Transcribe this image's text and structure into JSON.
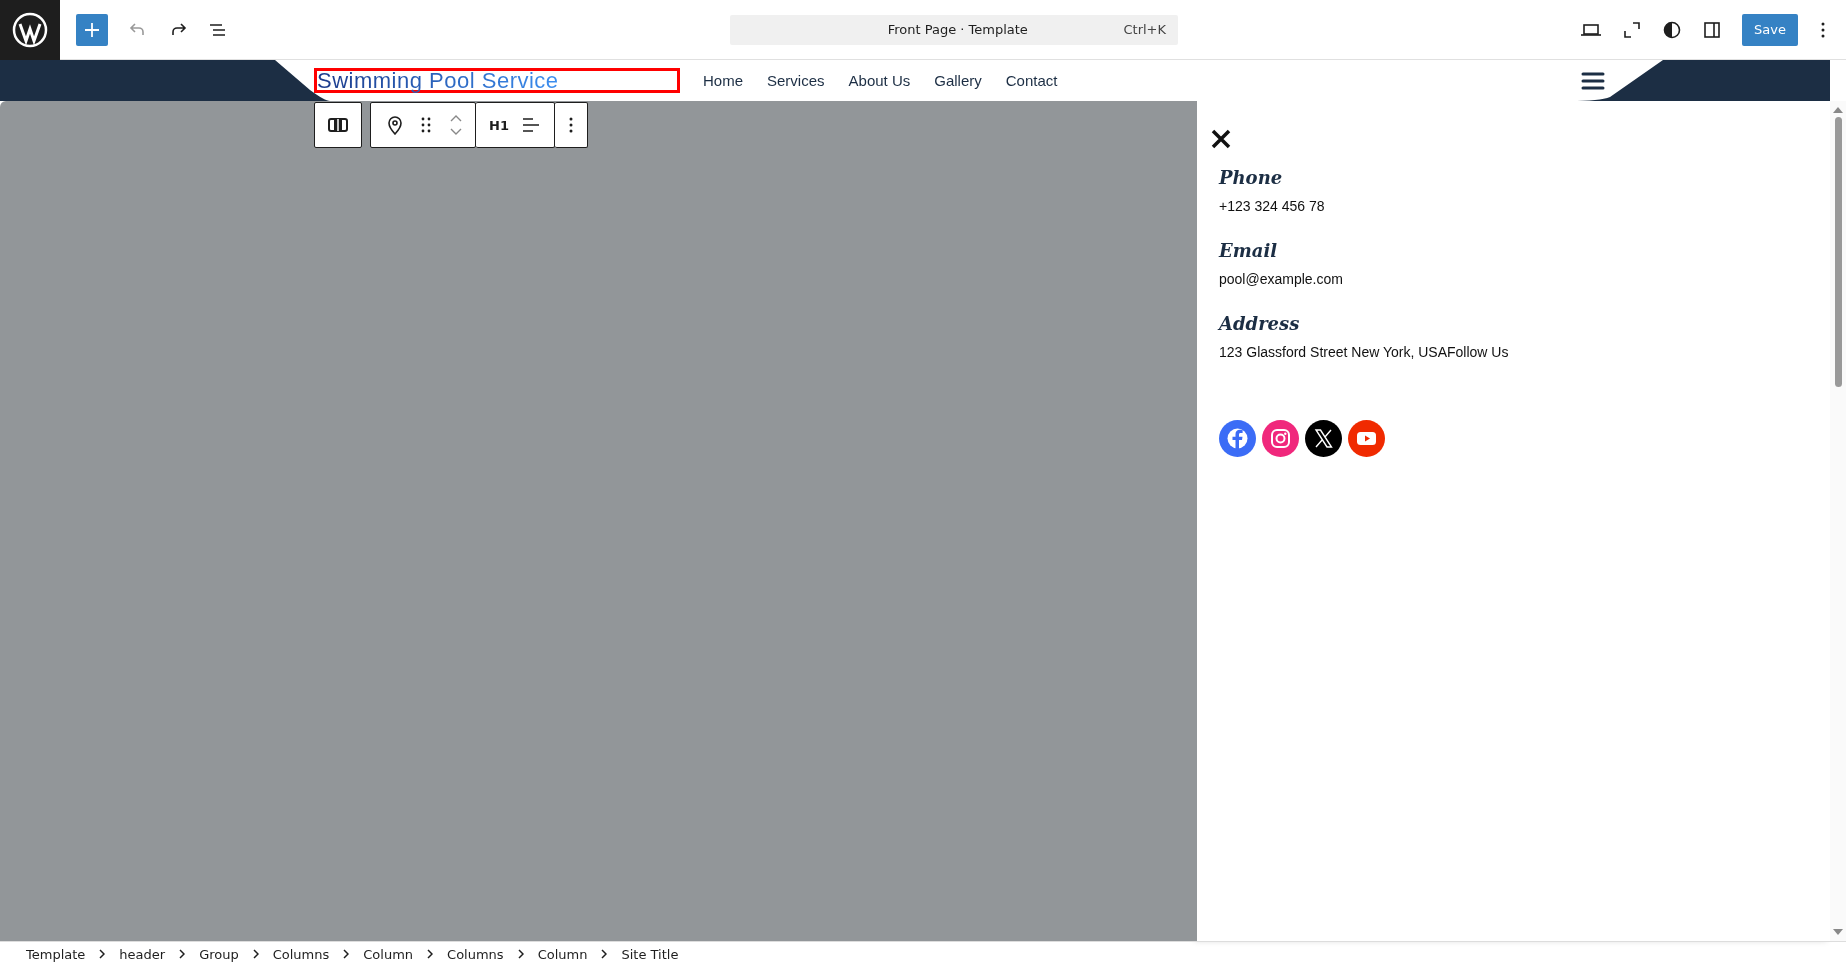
{
  "top_bar": {
    "command": "Front Page · Template",
    "shortcut": "Ctrl+K",
    "save": "Save"
  },
  "header": {
    "site_title": "Swimming Pool Service",
    "selected": true,
    "nav": [
      "Home",
      "Services",
      "About Us",
      "Gallery",
      "Contact"
    ]
  },
  "block_toolbar": {
    "heading_level": "H1"
  },
  "panel": {
    "contacts": [
      {
        "label": "Phone",
        "value": "+123 324 456 78"
      },
      {
        "label": "Email",
        "value": "pool@example.com"
      },
      {
        "label": "Address",
        "value": "123 Glassford Street New York, USAFollow Us"
      }
    ],
    "social": [
      {
        "kind": "facebook",
        "color": "#3b6cf6"
      },
      {
        "kind": "instagram",
        "color": "#f0287c"
      },
      {
        "kind": "x",
        "color": "#000000"
      },
      {
        "kind": "youtube",
        "color": "#f02a00"
      }
    ]
  },
  "breadcrumb": [
    "Template",
    "header",
    "Group",
    "Columns",
    "Column",
    "Columns",
    "Column",
    "Site Title"
  ]
}
